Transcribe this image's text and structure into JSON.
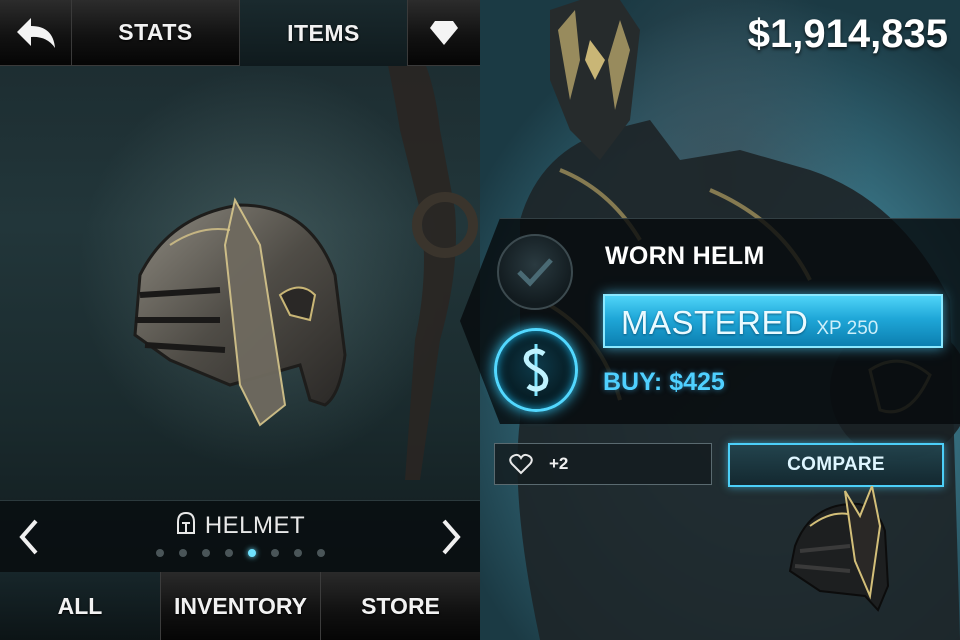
{
  "top_tabs": {
    "back_icon": "back-arrow-icon",
    "stats": "STATS",
    "items": "ITEMS",
    "gem_icon": "diamond-icon"
  },
  "currency": "$1,914,835",
  "category": {
    "label": "HELMET",
    "icon": "helmet-icon",
    "page_count": 8,
    "active_page": 5
  },
  "bottom_tabs": {
    "all": "ALL",
    "inventory": "INVENTORY",
    "store": "STORE",
    "active": "ALL"
  },
  "item": {
    "name": "WORN HELM",
    "status": "MASTERED",
    "xp": "XP 250",
    "buy": "BUY: $425",
    "likes": "+2",
    "compare": "COMPARE"
  },
  "colors": {
    "accent_cyan": "#4fd0ff",
    "mastered_bar": "#1fa7d8",
    "panel_dark": "#060a0c"
  }
}
